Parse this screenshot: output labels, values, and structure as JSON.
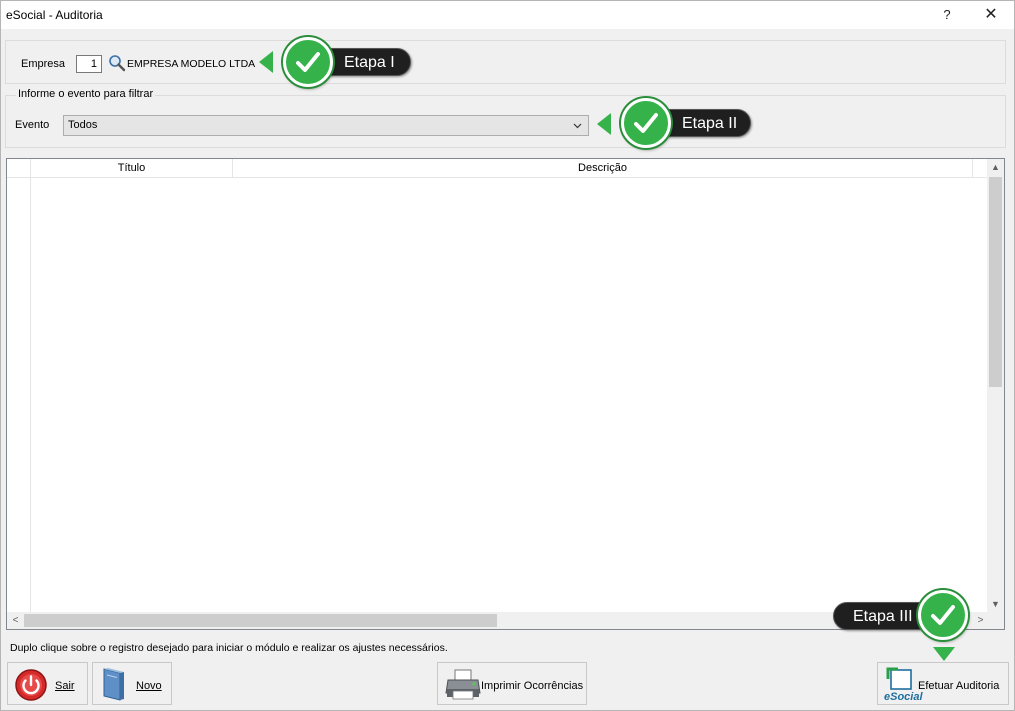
{
  "window": {
    "title": "eSocial - Auditoria",
    "help_label": "?",
    "close_label": "✕"
  },
  "empresa": {
    "label": "Empresa",
    "code": "1",
    "name": "EMPRESA MODELO LTDA",
    "search_icon": "magnifier-icon"
  },
  "filter": {
    "legend": "Informe o evento para filtrar",
    "evento_label": "Evento",
    "evento_value": "Todos"
  },
  "grid": {
    "columns": [
      "Título",
      "Descrição"
    ],
    "rows": []
  },
  "hint": "Duplo clique sobre o registro desejado para iniciar o módulo e realizar os ajustes necessários.",
  "buttons": {
    "sair": "Sair",
    "novo": "Novo",
    "imprimir": "Imprimir Ocorrências",
    "efetuar": "Efetuar Auditoria",
    "esocial_logo": "eSocial"
  },
  "callouts": {
    "etapa1": "Etapa I",
    "etapa2": "Etapa II",
    "etapa3": "Etapa III"
  },
  "colors": {
    "callout_green": "#36b24a",
    "callout_dark": "#1f1f1f",
    "sair_red": "#d42a2a"
  }
}
